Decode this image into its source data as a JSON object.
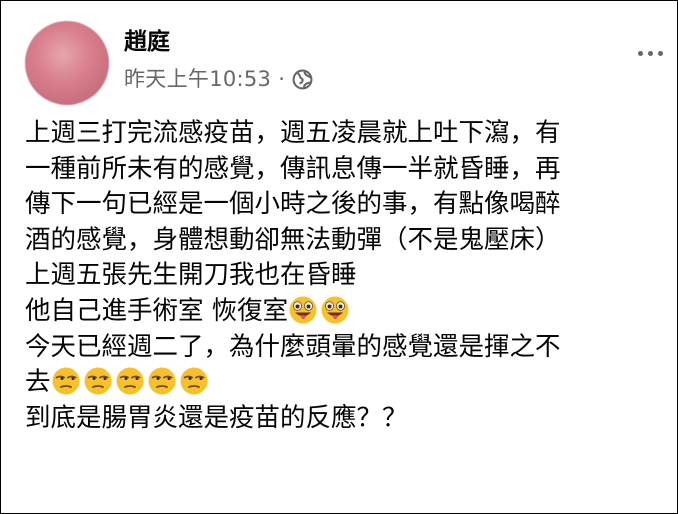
{
  "post": {
    "author_name": "趙庭",
    "timestamp": "昨天上午10:53",
    "separator": "·",
    "privacy_icon": "globe-icon",
    "more_icon": "more-horizontal-icon",
    "lines": [
      "上週三打完流感疫苗，週五凌晨就上吐下瀉，有",
      "一種前所未有的感覺，傳訊息傳一半就昏睡，再",
      "傳下一句已經是一個小時之後的事，有點像喝醉",
      "酒的感覺，身體想動卻無法動彈（不是鬼壓床）",
      "上週五張先生開刀我也在昏睡",
      "他自己進手術室 恢復室",
      "今天已經週二了，為什麼頭暈的感覺還是揮之不",
      "去",
      "到底是腸胃炎還是疫苗的反應？？"
    ],
    "emoji_goofy": "zany-tongue-emoji",
    "emoji_unamused": "unamused-emoji"
  },
  "colors": {
    "text": "#050505",
    "meta": "#65676b",
    "emoji_yellow": "#f7c12c"
  }
}
